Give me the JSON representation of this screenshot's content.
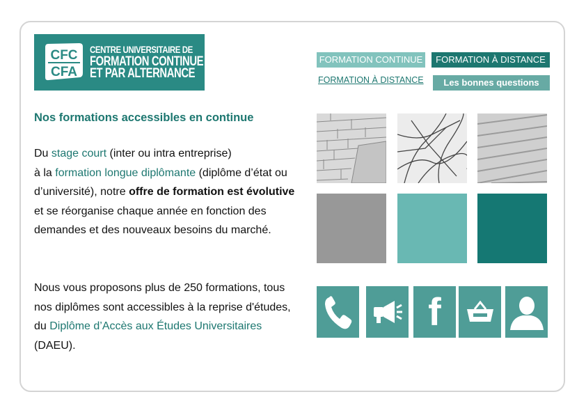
{
  "logo": {
    "mark_top": "CFC",
    "mark_bottom": "CFA",
    "line1": "CENTRE UNIVERSITAIRE DE",
    "line2": "FORMATION CONTINUE",
    "line3": "ET PAR ALTERNANCE"
  },
  "nav": {
    "formation_continue": "FORMATION CONTINUE",
    "formation_distance": "FORMATION À DISTANCE",
    "formation_distance_link": "FORMATION À DISTANCE",
    "bonnes_questions": "Les bonnes questions"
  },
  "content": {
    "heading": "Nos formations accessibles en continue",
    "p1": {
      "t1": "Du ",
      "link1": "stage court",
      "t2": " (inter ou intra entreprise)",
      "t3": "à la ",
      "link2": "formation longue diplômante",
      "t4": " (diplôme d’état ou d’université), notre ",
      "bold": "offre de formation est évolutive",
      "t5": " et se réorganise chaque année en fonction des demandes et  des nouveaux besoins du marché."
    },
    "p2": {
      "t1": "Nous vous proposons plus de 250 formations, tous nos diplômes sont accessibles à la reprise d'études, du ",
      "link": "Diplôme d’Accès aux Études Universitaires",
      "t2": " (DAEU)."
    }
  },
  "icons": {
    "phone": "phone-icon",
    "megaphone": "megaphone-icon",
    "facebook": "facebook-icon",
    "facebook_glyph": "f",
    "basket": "basket-icon",
    "user": "user-icon"
  },
  "colors": {
    "teal_dark": "#1d7770",
    "teal_mid": "#4f9d97",
    "teal_light": "#82c3bd",
    "logo_bg": "#2a8a84"
  }
}
